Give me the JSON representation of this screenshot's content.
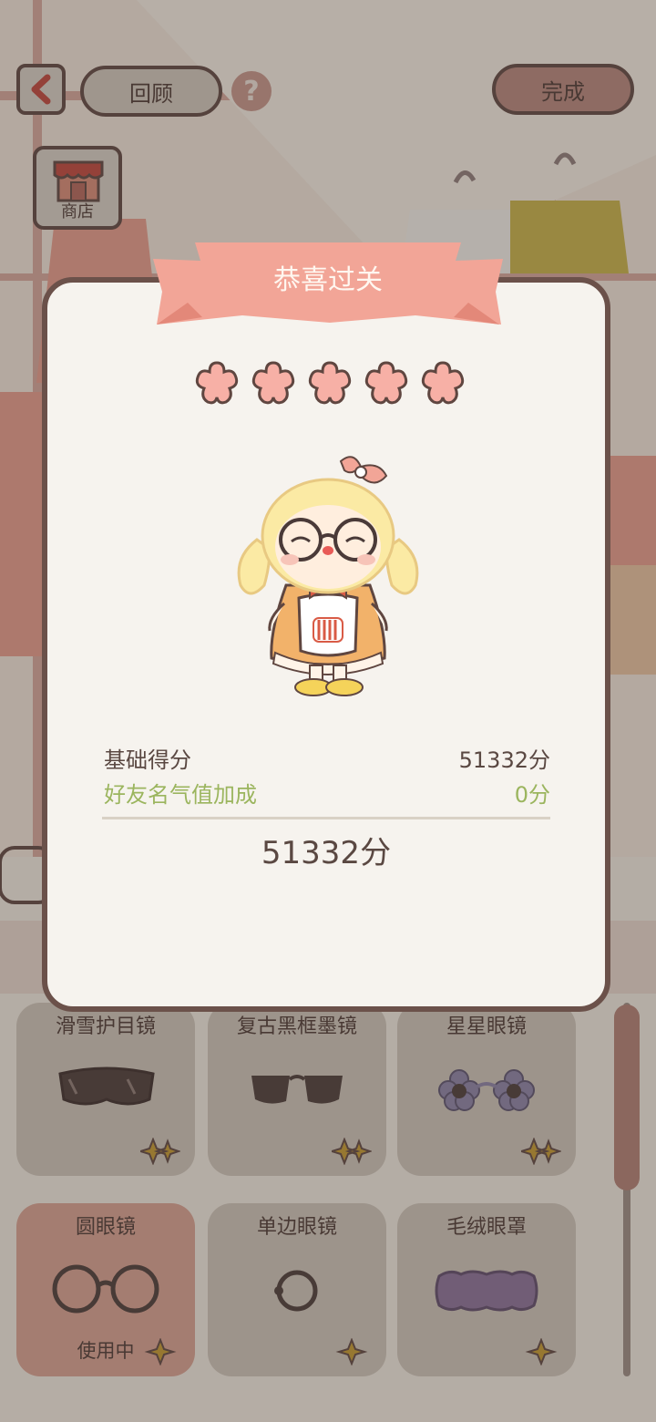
{
  "header": {
    "review_label": "回顾",
    "done_label": "完成",
    "help_glyph": "?"
  },
  "shop": {
    "label": "商店"
  },
  "result_card": {
    "title": "恭喜过关",
    "stars_earned": 5,
    "stars_total": 5,
    "scores": [
      {
        "label": "基础得分",
        "value": "51332分"
      },
      {
        "label": "好友名气值加成",
        "value": "0分"
      }
    ],
    "total": "51332分"
  },
  "inventory": {
    "items": [
      {
        "label": "滑雪护目镜",
        "icon": "ski-goggles-icon"
      },
      {
        "label": "复古黑框墨镜",
        "icon": "sunglasses-icon"
      },
      {
        "label": "星星眼镜",
        "icon": "flower-glasses-icon"
      },
      {
        "label": "圆眼镜",
        "icon": "round-glasses-icon",
        "selected": true,
        "status": "使用中"
      },
      {
        "label": "单边眼镜",
        "icon": "monocle-icon"
      },
      {
        "label": "毛绒眼罩",
        "icon": "plush-eye-mask-icon"
      }
    ],
    "scroll_position": 0
  },
  "colors": {
    "card_border": "#6b514a",
    "ribbon": "#f2a597",
    "star": "#f7b0a6",
    "bonus_text": "#9bb55e",
    "selected_item": "#d9a192"
  }
}
